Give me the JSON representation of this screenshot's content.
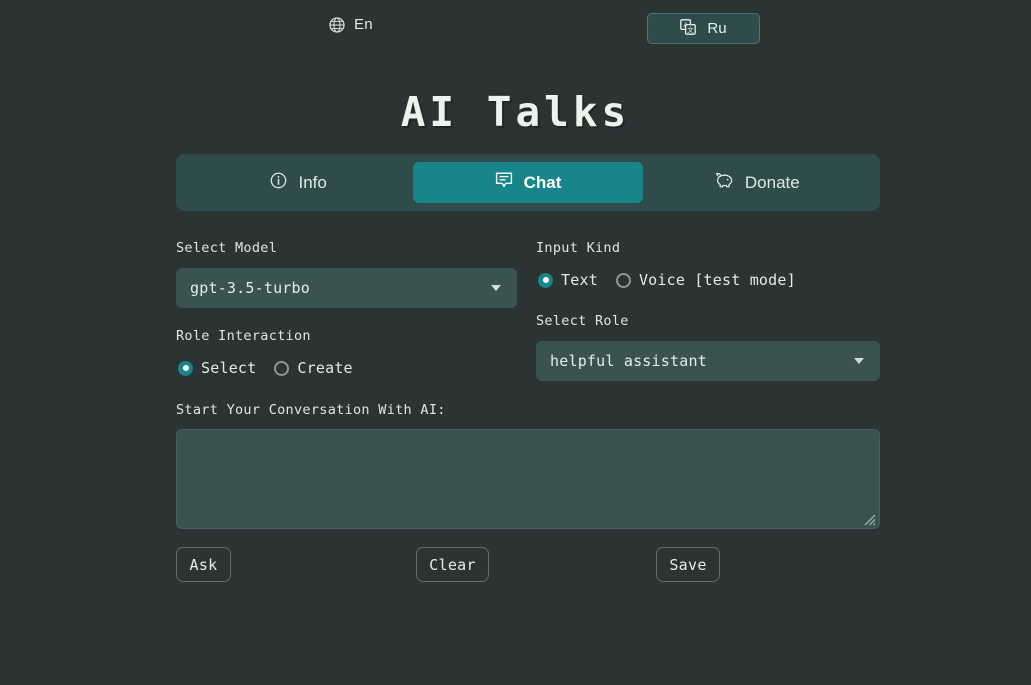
{
  "language_bar": {
    "current": {
      "icon": "globe-icon",
      "label": "En"
    },
    "switch": {
      "icon": "translate-icon",
      "label": "Ru"
    }
  },
  "header": {
    "title": "AI Talks"
  },
  "tabs": [
    {
      "id": "info",
      "label": "Info",
      "icon": "info-circle-icon",
      "active": false
    },
    {
      "id": "chat",
      "label": "Chat",
      "icon": "chat-bubble-icon",
      "active": true
    },
    {
      "id": "donate",
      "label": "Donate",
      "icon": "piggy-bank-icon",
      "active": false
    }
  ],
  "form": {
    "select_model": {
      "label": "Select Model",
      "value": "gpt-3.5-turbo"
    },
    "input_kind": {
      "label": "Input Kind",
      "options": [
        {
          "label": "Text",
          "selected": true
        },
        {
          "label": "Voice [test mode]",
          "selected": false
        }
      ]
    },
    "role_interaction": {
      "label": "Role Interaction",
      "options": [
        {
          "label": "Select",
          "selected": true
        },
        {
          "label": "Create",
          "selected": false
        }
      ]
    },
    "select_role": {
      "label": "Select Role",
      "value": "helpful assistant"
    },
    "conversation": {
      "label": "Start Your Conversation With AI:",
      "value": "",
      "placeholder": ""
    }
  },
  "actions": {
    "ask": "Ask",
    "clear": "Clear",
    "save": "Save"
  },
  "colors": {
    "background": "#2b3333",
    "panel": "#2f4b4a",
    "accent": "#17858a",
    "field": "#3a534f",
    "text": "#e6efe9"
  }
}
